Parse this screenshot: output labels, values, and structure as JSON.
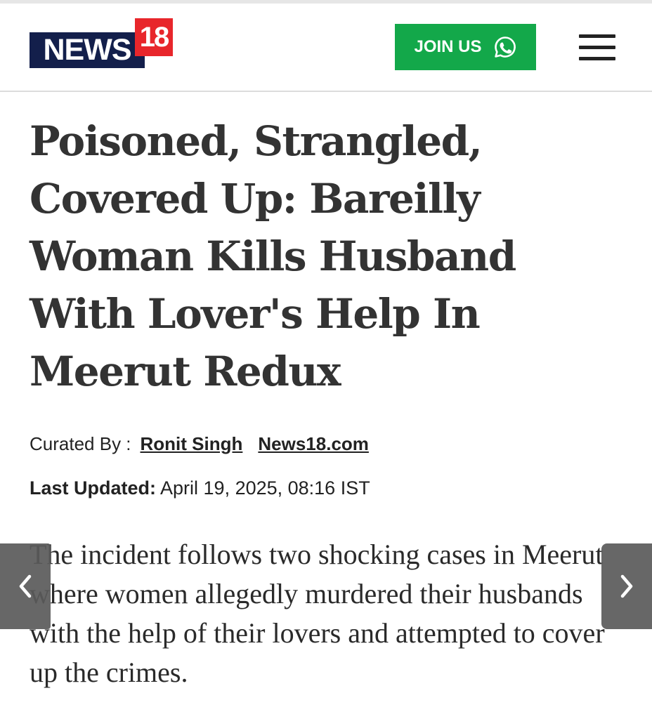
{
  "header": {
    "logo": {
      "word": "NEWS",
      "number": "18",
      "colors": {
        "navy": "#131f4b",
        "red": "#e8262b"
      }
    },
    "join_button": {
      "label": "JOIN US",
      "icon": "whatsapp-icon",
      "color": "#13a84a"
    },
    "menu_icon": "hamburger-menu-icon"
  },
  "article": {
    "headline": "Poisoned, Strangled, Covered Up: Bareilly Woman Kills Husband With Lover's Help In Meerut Redux",
    "byline": {
      "label": "Curated By :",
      "author": "Ronit Singh",
      "source": "News18.com"
    },
    "updated": {
      "label": "Last Updated:",
      "value": "April 19, 2025, 08:16 IST"
    },
    "summary": "The incident follows two shocking cases in Meerut where women allegedly murdered their husbands with the help of their lovers and attempted to cover up the crimes."
  },
  "carousel": {
    "prev_icon": "chevron-left-icon",
    "next_icon": "chevron-right-icon"
  }
}
